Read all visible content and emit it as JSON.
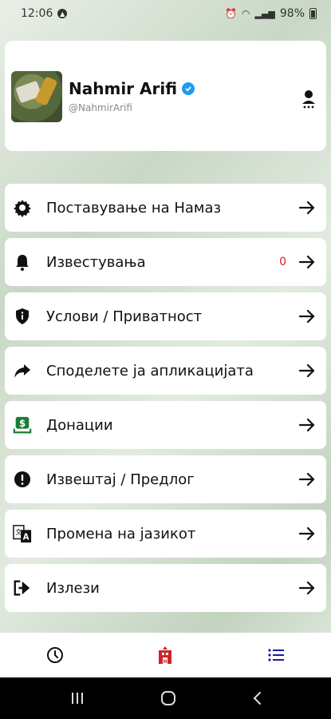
{
  "status_bar": {
    "time": "12:06",
    "battery": "98%"
  },
  "profile": {
    "name": "Nahmir Arifi",
    "handle": "@NahmirArifi"
  },
  "menu": {
    "items": [
      {
        "label": "Поставување на Намаз",
        "icon": "gear-icon"
      },
      {
        "label": "Известувања",
        "icon": "bell-icon",
        "badge": "0"
      },
      {
        "label": "Услови / Приватност",
        "icon": "shield-icon"
      },
      {
        "label": "Споделете ја апликацијата",
        "icon": "share-icon"
      },
      {
        "label": "Донации",
        "icon": "donation-icon"
      },
      {
        "label": "Извештај / Предлог",
        "icon": "alert-icon"
      },
      {
        "label": "Промена на јазикот",
        "icon": "translate-icon"
      },
      {
        "label": "Излези",
        "icon": "logout-icon"
      }
    ]
  },
  "bottom_nav": {
    "tabs": [
      "clock-icon",
      "mosque-icon",
      "list-icon"
    ]
  },
  "colors": {
    "accent": "#1a1aa0",
    "brand_red": "#d0242a",
    "badge_red": "#e02020",
    "verified_blue": "#1d9bf0"
  }
}
